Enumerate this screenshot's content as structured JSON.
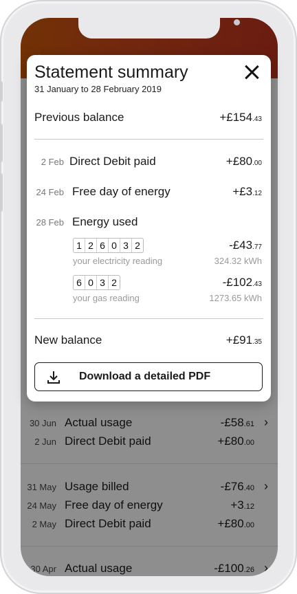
{
  "background_list": {
    "rows": [
      {
        "date": "30 Jun",
        "label": "Actual usage",
        "amount_main": "-£58",
        "amount_pence": ".61",
        "chevron": true
      },
      {
        "date": "2 Jun",
        "label": "Direct Debit paid",
        "amount_main": "+£80",
        "amount_pence": ".00",
        "chevron": false
      },
      {
        "date": "31 May",
        "label": "Usage billed",
        "amount_main": "-£76",
        "amount_pence": ".40",
        "chevron": true
      },
      {
        "date": "24 May",
        "label": "Free day of energy",
        "amount_main": "+3",
        "amount_pence": ".12",
        "chevron": false
      },
      {
        "date": "2 May",
        "label": "Direct Debit paid",
        "amount_main": "+£80",
        "amount_pence": ".00",
        "chevron": false
      },
      {
        "date": "30 Apr",
        "label": "Actual usage",
        "amount_main": "-£100",
        "amount_pence": ".26",
        "chevron": true
      }
    ]
  },
  "modal": {
    "title": "Statement summary",
    "period": "31 January to 28 February 2019",
    "previous_balance": {
      "label": "Previous balance",
      "main": "+£154",
      "pence": ".43"
    },
    "transactions": [
      {
        "date": "2 Feb",
        "label": "Direct Debit paid",
        "main": "+£80",
        "pence": ".00"
      },
      {
        "date": "24 Feb",
        "label": "Free day of energy",
        "main": "+£3",
        "pence": ".12"
      },
      {
        "date": "28 Feb",
        "label": "Energy used"
      }
    ],
    "electricity": {
      "digits": [
        "1",
        "2",
        "6",
        "0",
        "3",
        "2"
      ],
      "caption": "your electricity reading",
      "main": "-£43",
      "pence": ".77",
      "kwh": "324.32 kWh"
    },
    "gas": {
      "digits": [
        "6",
        "0",
        "3",
        "2"
      ],
      "caption": "your gas reading",
      "main": "-£102",
      "pence": ".43",
      "kwh": "1273.65 kWh"
    },
    "new_balance": {
      "label": "New balance",
      "main": "+£91",
      "pence": ".35"
    },
    "download_label": "Download a detailed PDF"
  },
  "icons": {
    "close": "close-icon",
    "download": "download-icon",
    "chevron": "chevron-right-icon",
    "back": "back-arrow-icon"
  },
  "colors": {
    "hero_start": "#c4560a",
    "hero_end": "#b8301e",
    "overlay": "rgba(0,0,0,0.42)"
  }
}
